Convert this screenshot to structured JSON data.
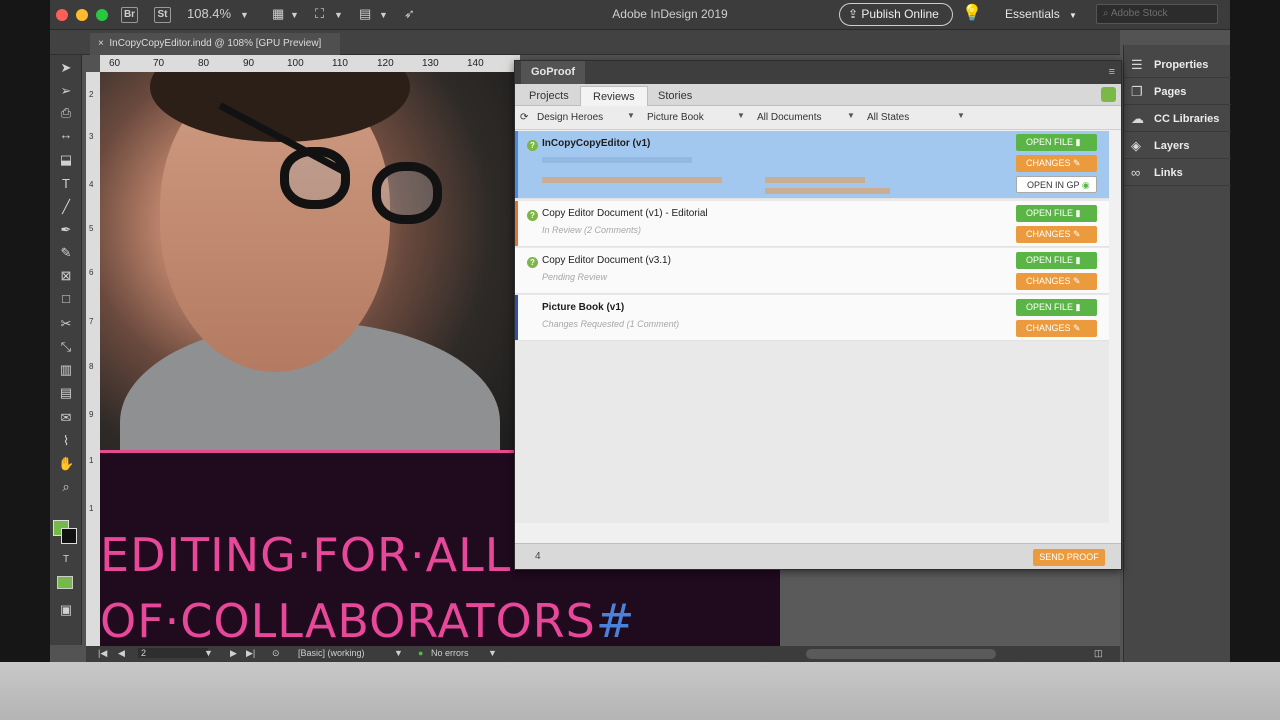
{
  "app": {
    "title": "Adobe InDesign 2019",
    "zoom": "108.4%",
    "publish_label": "Publish Online",
    "workspace": "Essentials",
    "search_placeholder": "Adobe Stock",
    "bridge_label": "Br",
    "stock_label": "St"
  },
  "document_tab": {
    "label": "InCopyCopyEditor.indd @ 108% [GPU Preview]"
  },
  "ruler": {
    "h_ticks": [
      "60",
      "70",
      "80",
      "90",
      "100",
      "110",
      "120",
      "130",
      "140"
    ],
    "v_ticks": [
      "2",
      "3",
      "4",
      "5",
      "6",
      "7",
      "8",
      "9",
      "1",
      "1"
    ]
  },
  "page": {
    "headline_line1": "EDITING·FOR·ALL",
    "headline_line2": "OF·COLLABORATORS",
    "headline_hash": "#"
  },
  "status_bar": {
    "page_number": "2",
    "style": "[Basic] (working)",
    "errors": "No errors"
  },
  "right_panel": {
    "items": [
      {
        "label": "Properties",
        "icon": "properties-icon"
      },
      {
        "label": "Pages",
        "icon": "pages-icon"
      },
      {
        "label": "CC Libraries",
        "icon": "cc-libraries-icon"
      },
      {
        "label": "Layers",
        "icon": "layers-icon"
      },
      {
        "label": "Links",
        "icon": "links-icon"
      }
    ]
  },
  "goproof": {
    "title": "GoProof",
    "tabs": [
      "Projects",
      "Reviews",
      "Stories"
    ],
    "active_tab": "Reviews",
    "filters": [
      "Design Heroes",
      "Picture Book",
      "All Documents",
      "All States"
    ],
    "open_file_label": "OPEN FILE",
    "changes_label": "CHANGES",
    "open_in_gp_label": "OPEN IN GP",
    "send_proof_label": "SEND PROOF",
    "count": "4",
    "rows": [
      {
        "title": "InCopyCopyEditor (v1)",
        "bold": true
      },
      {
        "title": "Copy Editor Document (v1) - Editorial",
        "bold": false,
        "status": "In Review",
        "comments": "(2 Comments)"
      },
      {
        "title": "Copy Editor Document (v3.1)",
        "bold": false,
        "status": "Pending Review",
        "comments": ""
      },
      {
        "title": "Picture Book (v1)",
        "bold": true,
        "status": "Changes Requested",
        "comments": "(1 Comment)"
      }
    ]
  },
  "colors": {
    "accent_pink": "#e8489a",
    "selected_row": "#a3c8ef",
    "button_green": "#5bb546",
    "button_orange": "#eb9b3e"
  }
}
